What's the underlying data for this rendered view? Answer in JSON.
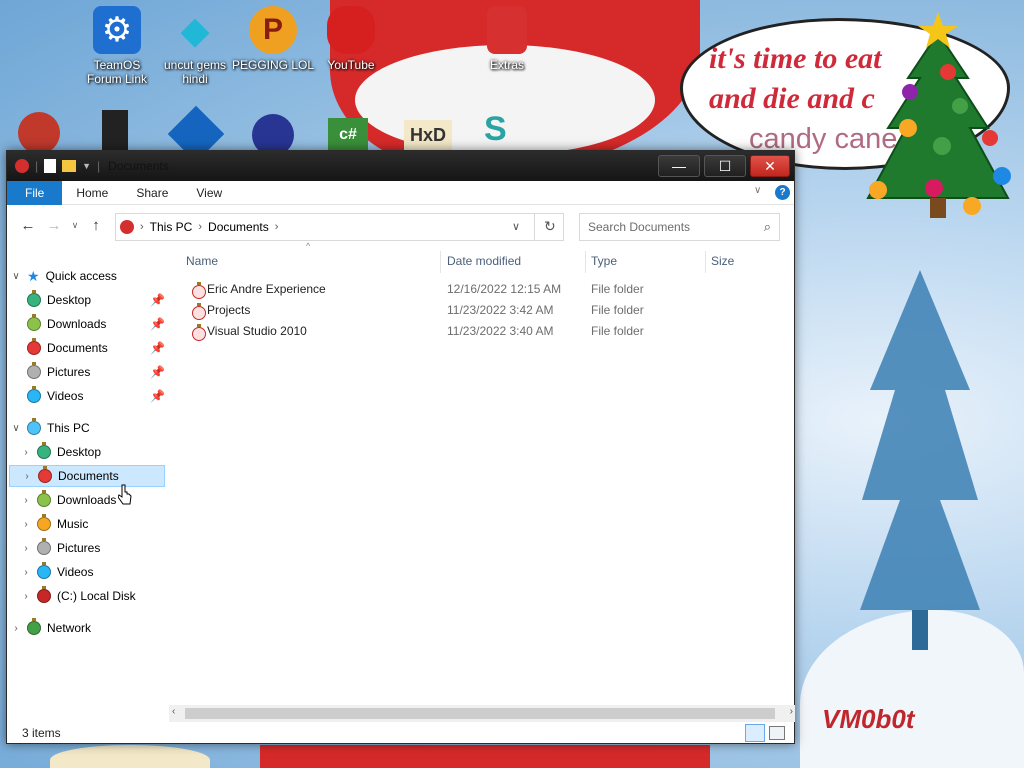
{
  "desktop": {
    "icons": [
      {
        "label": "TeamOS Forum Link",
        "icon": "gear-icon",
        "color": "#1f6fd1"
      },
      {
        "label": "uncut gems hindi",
        "icon": "gem-icon",
        "color": "#21b8d8"
      },
      {
        "label": "PEGGING LOL",
        "icon": "p-logo-icon",
        "color": "#f0a020"
      },
      {
        "label": "YouTube",
        "icon": "angry-bird-icon",
        "color": "#d62020"
      },
      {
        "label": "Extras",
        "icon": "gift-box-icon",
        "color": "#d63030"
      }
    ],
    "bubble_lines": [
      "it's time to eat",
      "and die and c",
      "candy cane"
    ],
    "watermark": "VM0b0t",
    "small_icons_row2": [
      "recycle-icon",
      "pc-tower-icon",
      "badge-2-icon",
      "bomb-icon",
      "csharp-icon",
      "hxd-icon",
      "python-icon"
    ]
  },
  "window": {
    "title": "Documents",
    "controls": {
      "minimize": "—",
      "maximize": "☐",
      "close": "✕"
    },
    "ribbon_tabs": [
      "File",
      "Home",
      "Share",
      "View"
    ],
    "address": {
      "root": "This PC",
      "current": "Documents"
    },
    "search": {
      "placeholder": "Search Documents"
    },
    "sidebar": {
      "quick_access": {
        "label": "Quick access",
        "items": [
          {
            "label": "Desktop",
            "color": "#36b37e"
          },
          {
            "label": "Downloads",
            "color": "#8bc34a"
          },
          {
            "label": "Documents",
            "color": "#e53935"
          },
          {
            "label": "Pictures",
            "color": "#b0b0b0"
          },
          {
            "label": "Videos",
            "color": "#29b6f6"
          }
        ]
      },
      "this_pc": {
        "label": "This PC",
        "items": [
          {
            "label": "Desktop",
            "color": "#36b37e"
          },
          {
            "label": "Documents",
            "color": "#e53935"
          },
          {
            "label": "Downloads",
            "color": "#8bc34a"
          },
          {
            "label": "Music",
            "color": "#f5a623"
          },
          {
            "label": "Pictures",
            "color": "#b0b0b0"
          },
          {
            "label": "Videos",
            "color": "#29b6f6"
          },
          {
            "label": "(C:) Local Disk",
            "color": "#c62828"
          }
        ]
      },
      "network": {
        "label": "Network",
        "color": "#43a047"
      }
    },
    "columns": [
      "Name",
      "Date modified",
      "Type",
      "Size"
    ],
    "files": [
      {
        "name": "Eric Andre Experience",
        "date": "12/16/2022 12:15 AM",
        "type": "File folder",
        "size": ""
      },
      {
        "name": "Projects",
        "date": "11/23/2022 3:42 AM",
        "type": "File folder",
        "size": ""
      },
      {
        "name": "Visual Studio 2010",
        "date": "11/23/2022 3:40 AM",
        "type": "File folder",
        "size": ""
      }
    ],
    "status": "3 items"
  }
}
